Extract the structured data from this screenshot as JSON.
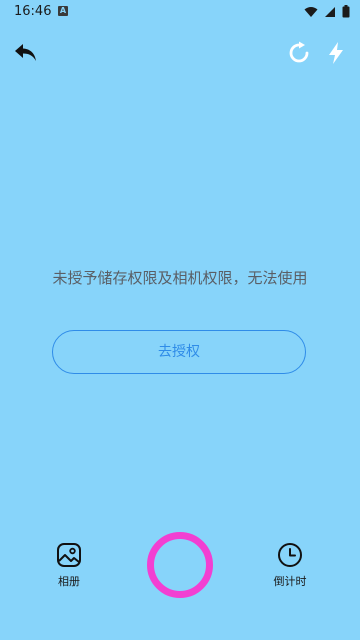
{
  "status_bar": {
    "time": "16:46",
    "indicator": "A"
  },
  "main": {
    "message": "未授予储存权限及相机权限，无法使用",
    "auth_button_label": "去授权"
  },
  "bottom_bar": {
    "album_label": "相册",
    "timer_label": "倒计时"
  },
  "colors": {
    "background": "#87d4fa",
    "accent": "#2f8ce8",
    "shutter": "#f23fd2"
  },
  "icons": [
    "back-icon",
    "rotate-icon",
    "flash-icon",
    "gallery-icon",
    "timer-icon",
    "wifi-icon",
    "signal-icon",
    "battery-icon"
  ]
}
